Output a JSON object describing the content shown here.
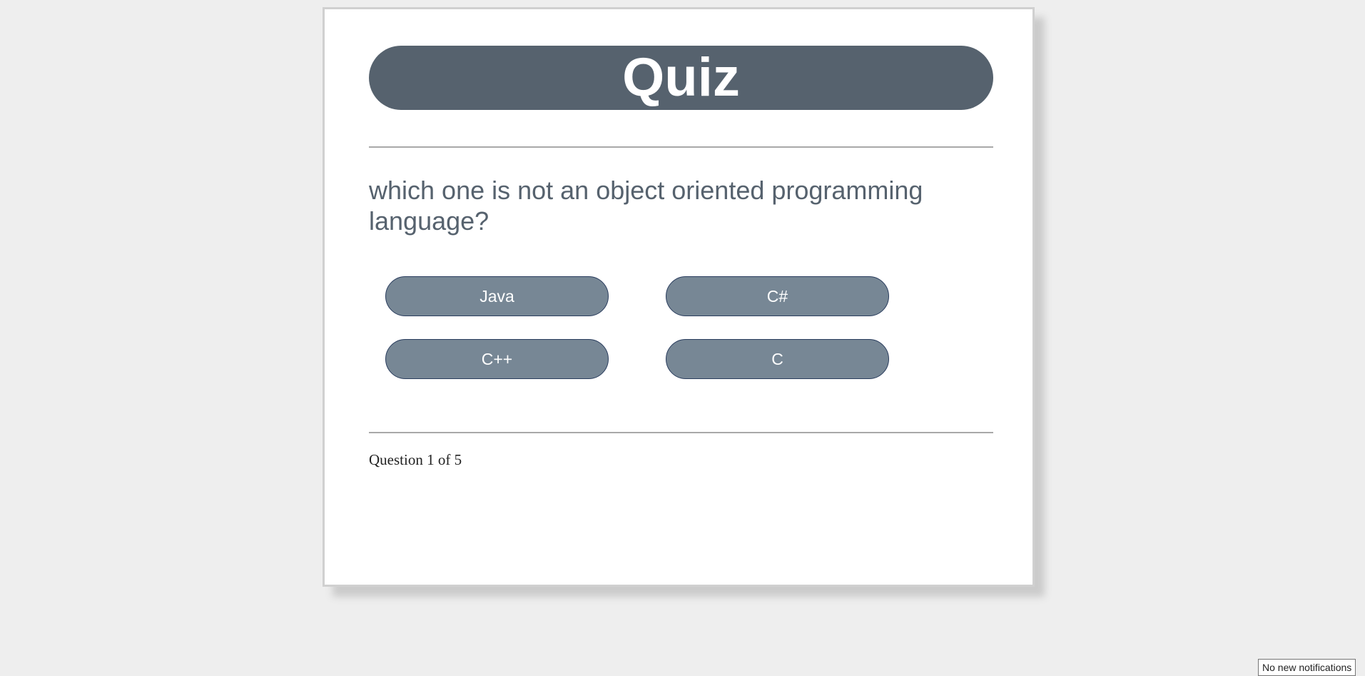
{
  "quiz": {
    "title": "Quiz",
    "question": "which one is not an object oriented programming language?",
    "choices": [
      {
        "label": "Java"
      },
      {
        "label": "C#"
      },
      {
        "label": "C++"
      },
      {
        "label": "C"
      }
    ],
    "progress": "Question 1 of 5"
  },
  "notifications": {
    "status": "No new notifications"
  },
  "colors": {
    "page_background": "#eeeeee",
    "card_background": "#ffffff",
    "header_background": "#56626e",
    "question_text": "#56626e",
    "button_background": "#778795",
    "button_border": "#2a3d5e"
  }
}
